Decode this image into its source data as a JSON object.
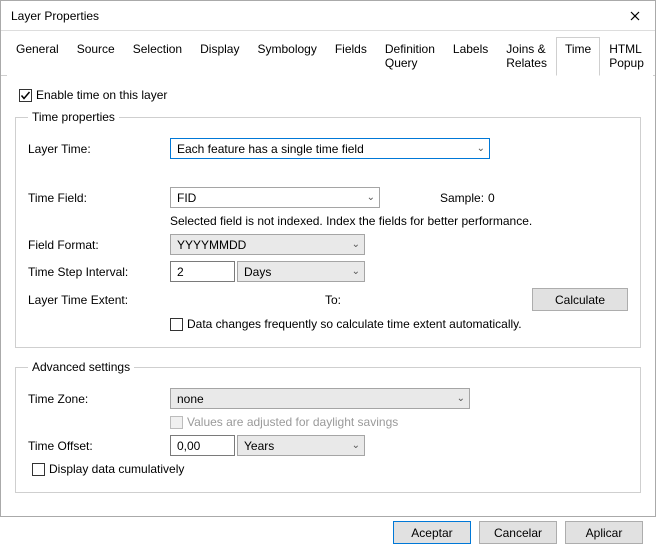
{
  "window": {
    "title": "Layer Properties"
  },
  "tabs": {
    "general": "General",
    "source": "Source",
    "selection": "Selection",
    "display": "Display",
    "symbology": "Symbology",
    "fields": "Fields",
    "definition_query": "Definition Query",
    "labels": "Labels",
    "joins_relates": "Joins & Relates",
    "time": "Time",
    "html_popup": "HTML Popup"
  },
  "enable_time_label": "Enable time on this layer",
  "time_props": {
    "legend": "Time properties",
    "layer_time_label": "Layer Time:",
    "layer_time_value": "Each feature has a single time field",
    "time_field_label": "Time Field:",
    "time_field_value": "FID",
    "sample_label": "Sample:",
    "sample_value": "0",
    "index_note": "Selected field is not indexed. Index the fields for better performance.",
    "field_format_label": "Field Format:",
    "field_format_value": "YYYYMMDD",
    "step_label": "Time Step Interval:",
    "step_value": "2",
    "step_unit": "Days",
    "extent_label": "Layer Time Extent:",
    "extent_to": "To:",
    "calculate_btn": "Calculate",
    "data_changes_label": "Data changes frequently so calculate time extent automatically."
  },
  "advanced": {
    "legend": "Advanced settings",
    "tz_label": "Time Zone:",
    "tz_value": "none",
    "dst_label": "Values are adjusted for daylight savings",
    "offset_label": "Time Offset:",
    "offset_value": "0,00",
    "offset_unit": "Years",
    "cumulative_label": "Display data cumulatively"
  },
  "footer": {
    "ok": "Aceptar",
    "cancel": "Cancelar",
    "apply": "Aplicar"
  }
}
